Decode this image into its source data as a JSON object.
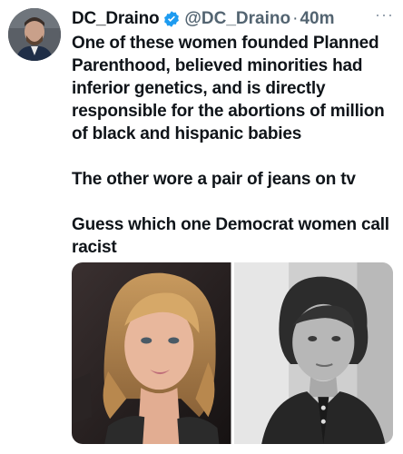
{
  "tweet": {
    "author_name": "DC_Draino",
    "handle": "@DC_Draino",
    "separator": "·",
    "time": "40m",
    "more_glyph": "···",
    "verified": true,
    "paragraphs": [
      "One of these women founded Planned Parenthood, believed minorities had inferior genetics, and is directly responsible for the abortions of million of black and hispanic babies",
      "The other wore a pair of jeans on tv",
      "Guess which one Democrat women call racist"
    ],
    "media": {
      "left_photo": "color-portrait-blonde-woman",
      "right_photo": "black-and-white-portrait-woman"
    }
  },
  "colors": {
    "text": "#0f1419",
    "secondary": "#536471",
    "verified_badge": "#1d9bf0"
  }
}
